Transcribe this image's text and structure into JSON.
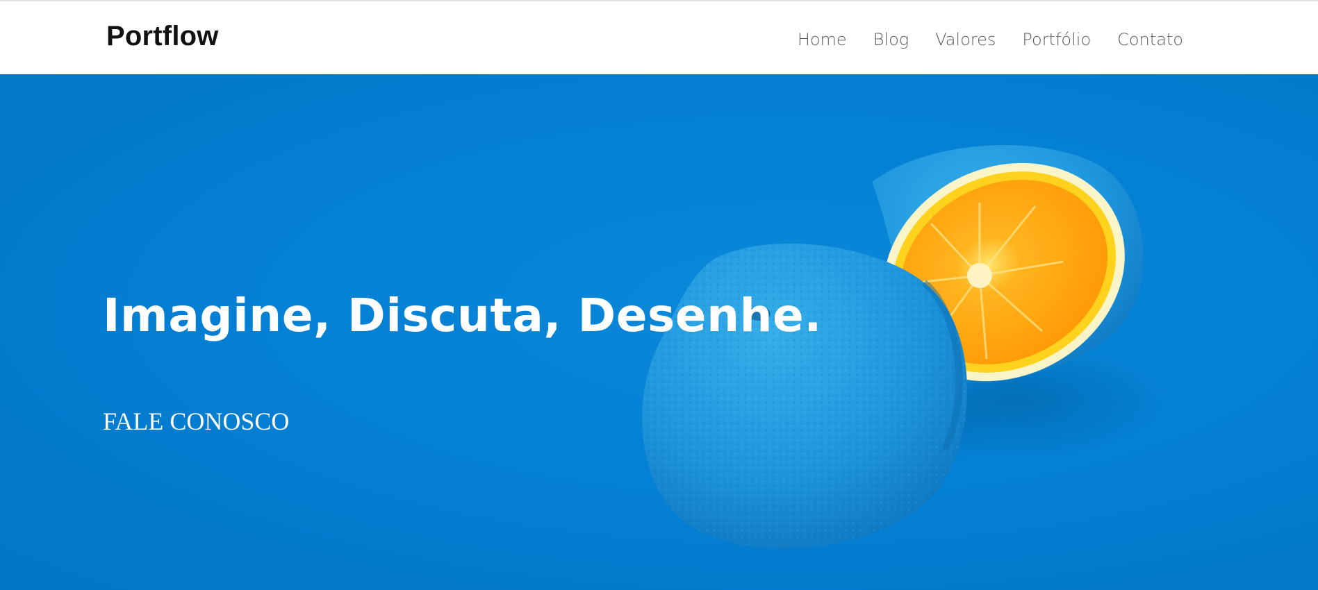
{
  "header": {
    "brand": "Portflow",
    "nav": [
      "Home",
      "Blog",
      "Valores",
      "Portfólio",
      "Contato"
    ]
  },
  "hero": {
    "headline": "Imagine, Discuta, Desenhe.",
    "cta": "FALE CONOSCO",
    "image": "blue-painted-orange-halves"
  },
  "colors": {
    "hero_background": "#0480d4",
    "nav_text": "#5b5b5b",
    "brand_text": "#111111",
    "orange": "#ff9f0f"
  }
}
